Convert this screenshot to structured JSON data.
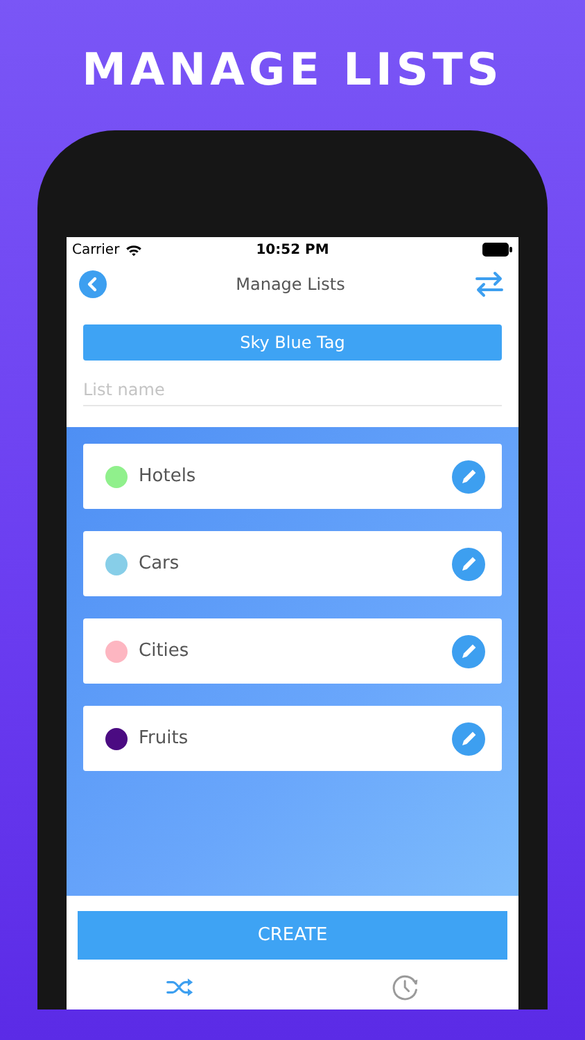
{
  "headline": "MANAGE LISTS",
  "status_bar": {
    "carrier": "Carrier",
    "time": "10:52 PM"
  },
  "nav": {
    "title": "Manage Lists"
  },
  "tag_button": {
    "label": "Sky Blue Tag"
  },
  "list_name": {
    "placeholder": "List name"
  },
  "lists": [
    {
      "name": "Hotels",
      "color": "#90f08c"
    },
    {
      "name": "Cars",
      "color": "#87cee8"
    },
    {
      "name": "Cities",
      "color": "#fdb6c1"
    },
    {
      "name": "Fruits",
      "color": "#4b0b82"
    }
  ],
  "create_button": {
    "label": "CREATE"
  },
  "tabs": [
    {
      "kind": "shuffle",
      "selected": true
    },
    {
      "kind": "history",
      "selected": false
    }
  ]
}
